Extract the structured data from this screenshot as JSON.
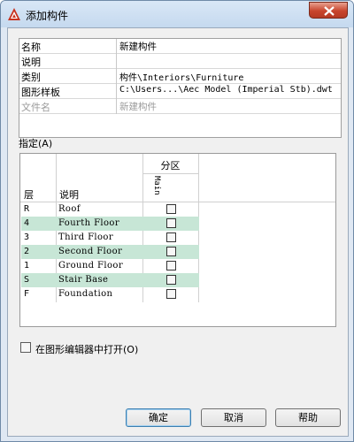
{
  "window": {
    "title": "添加构件",
    "icon": "autocad-logo-icon",
    "accent": "#c8452d"
  },
  "properties": [
    {
      "key": "名称",
      "value": "新建构件",
      "disabled": false,
      "mono": false
    },
    {
      "key": "说明",
      "value": "",
      "disabled": false,
      "mono": false
    },
    {
      "key": "类别",
      "value": "构件\\Interiors\\Furniture",
      "disabled": false,
      "mono": false
    },
    {
      "key": "图形样板",
      "value": "C:\\Users...\\Aec Model (Imperial Stb).dwt",
      "disabled": false,
      "mono": false
    },
    {
      "key": "文件名",
      "value": "新建构件",
      "disabled": true,
      "mono": false
    }
  ],
  "assign": {
    "label": "指定(A)",
    "header_group": "分区",
    "header_division": "Main",
    "col_layer": "层",
    "col_desc": "说明",
    "rows": [
      {
        "layer": "R",
        "desc": "Roof",
        "alt": false,
        "checked": false
      },
      {
        "layer": "4",
        "desc": "Fourth Floor",
        "alt": true,
        "checked": false
      },
      {
        "layer": "3",
        "desc": "Third Floor",
        "alt": false,
        "checked": false
      },
      {
        "layer": "2",
        "desc": "Second Floor",
        "alt": true,
        "checked": false
      },
      {
        "layer": "1",
        "desc": "Ground Floor",
        "alt": false,
        "checked": false
      },
      {
        "layer": "S",
        "desc": "Stair Base",
        "alt": true,
        "checked": false
      },
      {
        "layer": "F",
        "desc": "Foundation",
        "alt": false,
        "checked": false
      }
    ],
    "alt_row_color": "#c7e6d6"
  },
  "open_in_editor": {
    "label": "在图形编辑器中打开(O)",
    "checked": false
  },
  "buttons": {
    "ok": "确定",
    "cancel": "取消",
    "help": "帮助"
  }
}
